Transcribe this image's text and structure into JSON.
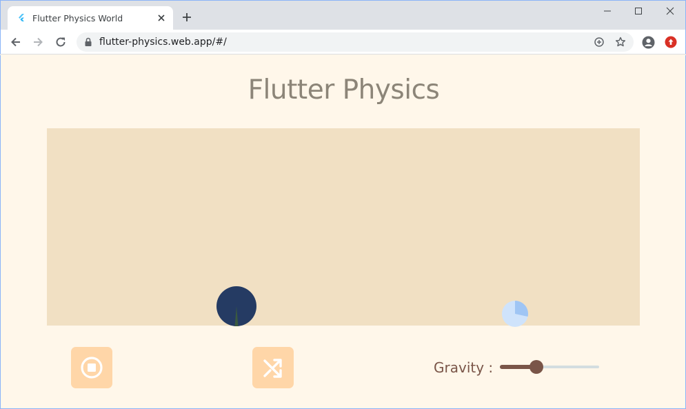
{
  "browser": {
    "tab_title": "Flutter Physics World",
    "url": "flutter-physics.web.app/#/"
  },
  "app": {
    "title": "Flutter Physics",
    "gravity_label": "Gravity :",
    "gravity_value": 0.35
  },
  "colors": {
    "background": "#fff7ea",
    "world": "#f1e0c3",
    "title": "#8c8578",
    "button": "#ffd6a8",
    "slider": "#7a5548",
    "ball_large": "#253b63",
    "ball_small": "#cfe3fb"
  },
  "icons": {
    "stop_button": "stop-circle-icon",
    "shuffle_button": "shuffle-icon"
  }
}
